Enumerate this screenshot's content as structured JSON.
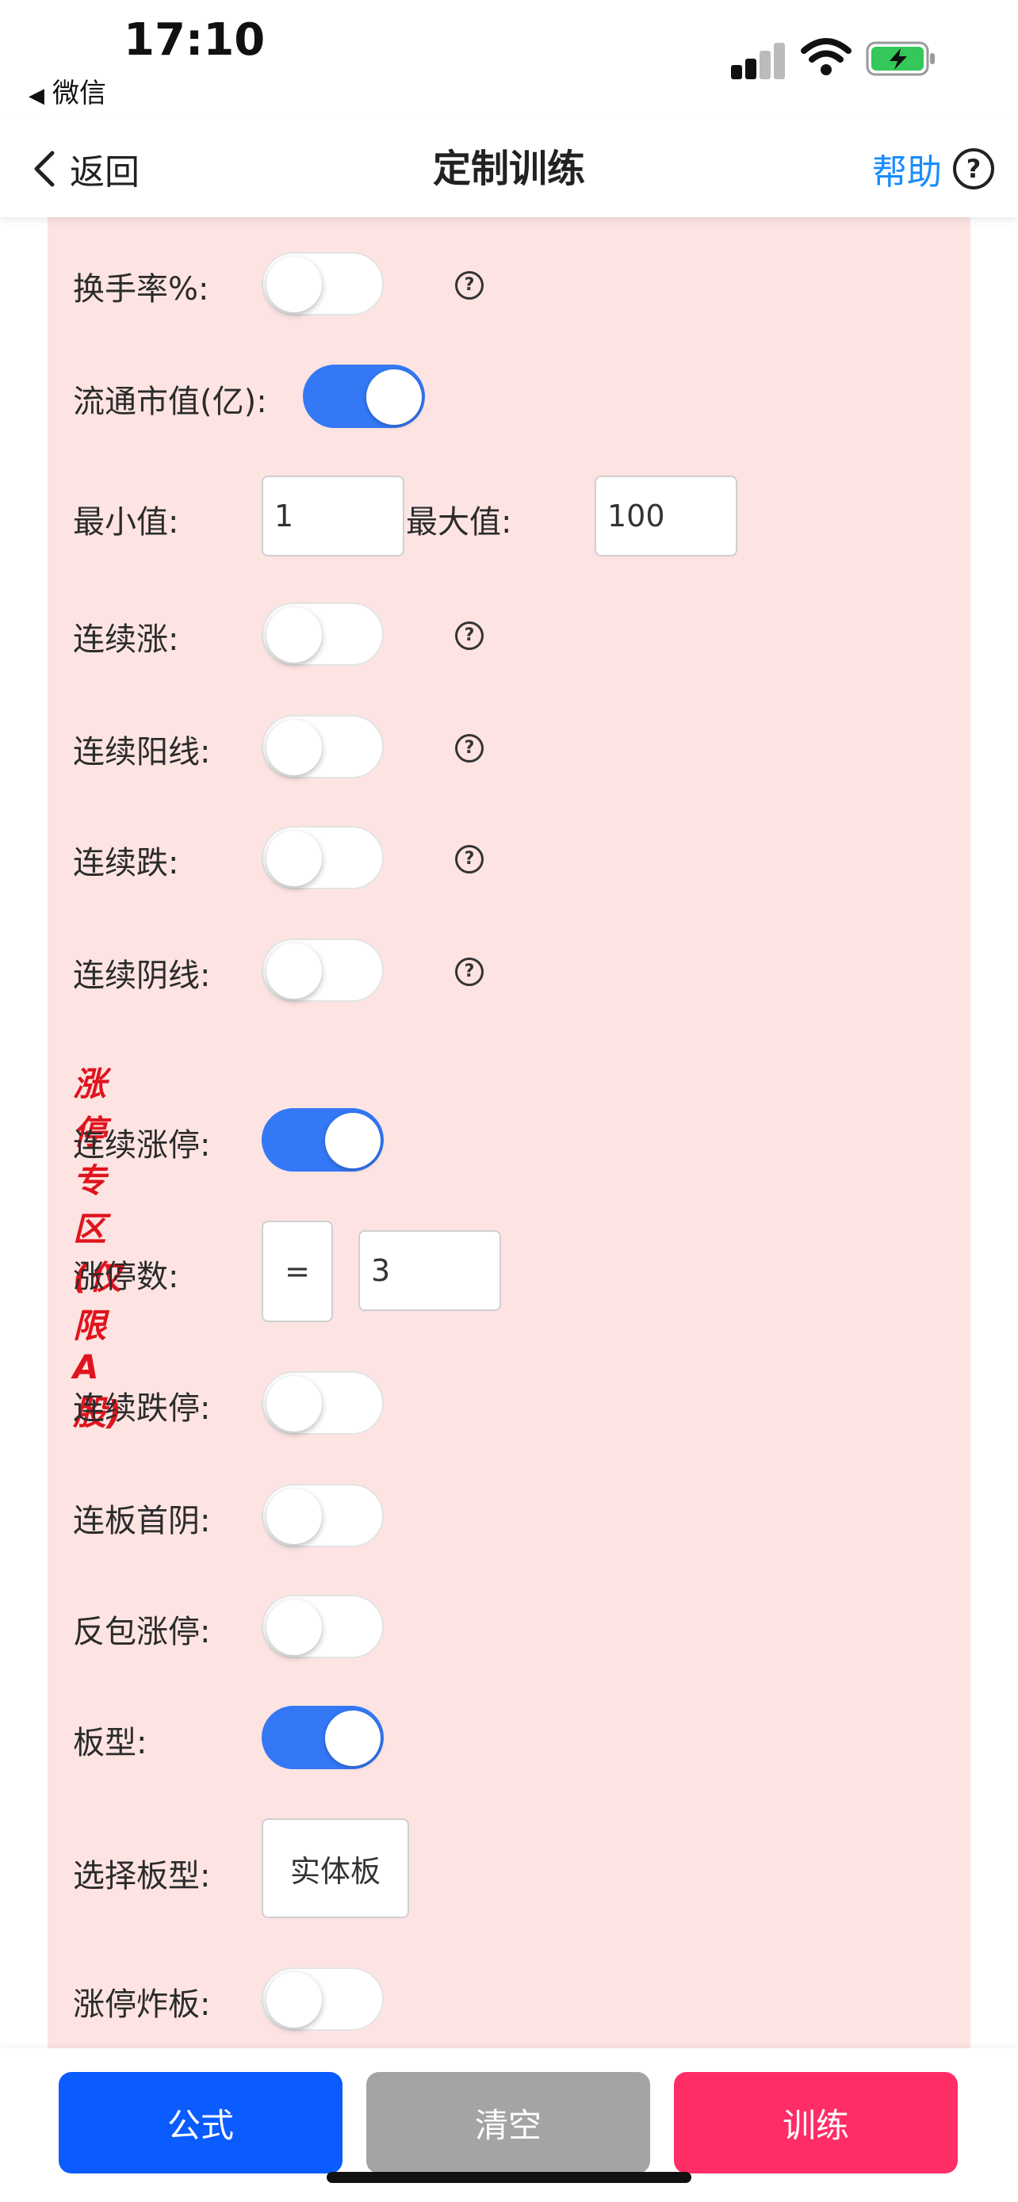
{
  "status": {
    "time": "17:10",
    "back_app": "微信"
  },
  "nav": {
    "back_label": "返回",
    "title": "定制训练",
    "help_label": "帮助"
  },
  "rows": {
    "turnover": {
      "label": "换手率%:",
      "on": false
    },
    "float_cap": {
      "label": "流通市值(亿):",
      "on": true
    },
    "range": {
      "min_label": "最小值:",
      "min_value": "1",
      "max_label": "最大值:",
      "max_value": "100"
    },
    "cons_up": {
      "label": "连续涨:",
      "on": false
    },
    "cons_yang": {
      "label": "连续阳线:",
      "on": false
    },
    "cons_down": {
      "label": "连续跌:",
      "on": false
    },
    "cons_yin": {
      "label": "连续阴线:",
      "on": false
    }
  },
  "limit_zone": {
    "title": "涨停专区(仅限A股)",
    "cons_limit_up": {
      "label": "连续涨停:",
      "on": true
    },
    "limit_count": {
      "label": "涨停数:",
      "operator": "=",
      "value": "3"
    },
    "cons_limit_down": {
      "label": "连续跌停:",
      "on": false
    },
    "first_yin": {
      "label": "连板首阴:",
      "on": false
    },
    "reverse_limit": {
      "label": "反包涨停:",
      "on": false
    },
    "board_type": {
      "label": "板型:",
      "on": true
    },
    "select_board": {
      "label": "选择板型:",
      "value": "实体板"
    },
    "limit_break": {
      "label": "涨停炸板:",
      "on": false
    }
  },
  "buttons": {
    "formula": {
      "label": "公式",
      "color": "#0a5cff"
    },
    "clear": {
      "label": "清空",
      "color": "#a4a4a4"
    },
    "train": {
      "label": "训练",
      "color": "#ff2d66"
    }
  }
}
